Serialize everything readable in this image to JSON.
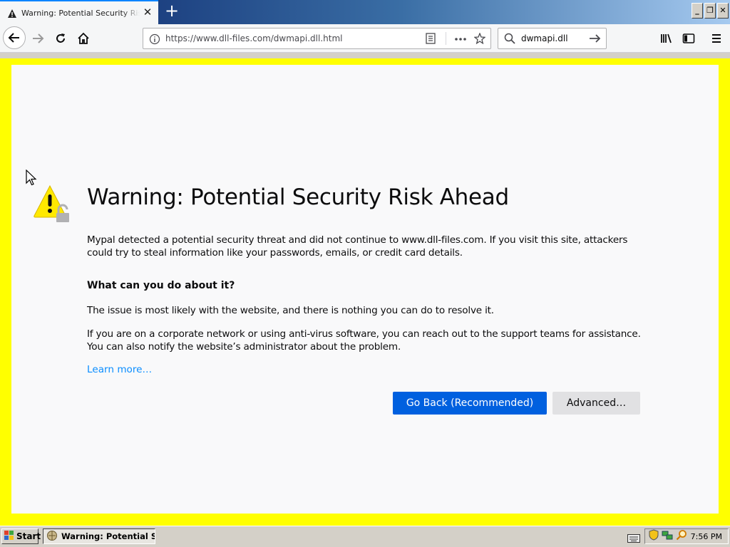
{
  "tab": {
    "title": "Warning: Potential Security Risk Ahead",
    "close": "✕",
    "new_tab": "+"
  },
  "window_controls": {
    "minimize": "_",
    "restore": "❐",
    "close": "✕"
  },
  "navbar": {
    "url": "https://www.dll-files.com/dwmapi.dll.html",
    "search_value": "dwmapi.dll"
  },
  "page": {
    "heading": "Warning: Potential Security Risk Ahead",
    "intro": "Mypal detected a potential security threat and did not continue to www.dll-files.com. If you visit this site, attackers could try to steal information like your passwords, emails, or credit card details.",
    "subheading": "What can you do about it?",
    "para1": "The issue is most likely with the website, and there is nothing you can do to resolve it.",
    "para2": "If you are on a corporate network or using anti-virus software, you can reach out to the support teams for assistance. You can also notify the website’s administrator about the problem.",
    "learn_more": "Learn more…",
    "go_back": "Go Back (Recommended)",
    "advanced": "Advanced…"
  },
  "taskbar": {
    "start": "Start",
    "task_item": "Warning: Potential Se...",
    "clock": "7:56 PM"
  },
  "colors": {
    "frame_border": "#ffff00",
    "primary_button": "#0060df",
    "link": "#0a8dff",
    "warning": "#ffe900"
  }
}
